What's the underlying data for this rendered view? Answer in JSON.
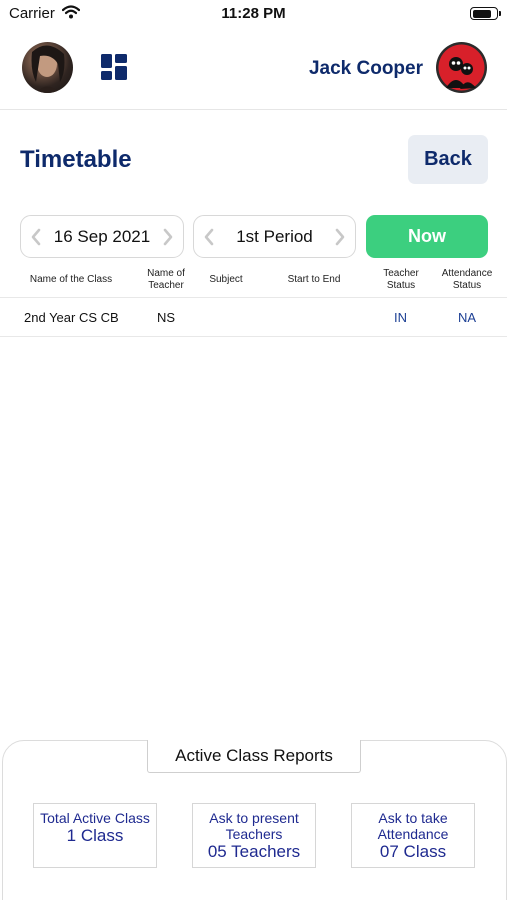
{
  "status_bar": {
    "carrier": "Carrier",
    "time": "11:28 PM",
    "battery_level": 0.85
  },
  "header": {
    "user_name": "Jack Cooper",
    "left_avatar": "user-photo-avatar",
    "right_avatar": "cartoon-avatar",
    "dashboard_icon": "dashboard-grid-icon"
  },
  "page": {
    "title": "Timetable",
    "back_label": "Back"
  },
  "filters": {
    "date": "16 Sep 2021",
    "period": "1st Period",
    "now_label": "Now"
  },
  "table": {
    "columns": [
      "Name of the Class",
      "Name of Teacher",
      "Subject",
      "Start to End",
      "Teacher Status",
      "Attendance Status"
    ],
    "rows": [
      {
        "class_name": "2nd Year CS CB",
        "teacher": "NS",
        "subject": "",
        "start_end": "",
        "teacher_status": "IN",
        "attendance_status": "NA"
      }
    ]
  },
  "reports": {
    "tab_label": "Active Class Reports",
    "cards": [
      {
        "label": "Total Active Class",
        "value": "1 Class"
      },
      {
        "label": "Ask to present Teachers",
        "value": "05 Teachers"
      },
      {
        "label": "Ask to take Attendance",
        "value": "07 Class"
      }
    ]
  },
  "colors": {
    "brand": "#0e2a6b",
    "accent_green": "#3ccf7f",
    "link_blue": "#1c3f94",
    "report_text": "#1f2a90"
  }
}
